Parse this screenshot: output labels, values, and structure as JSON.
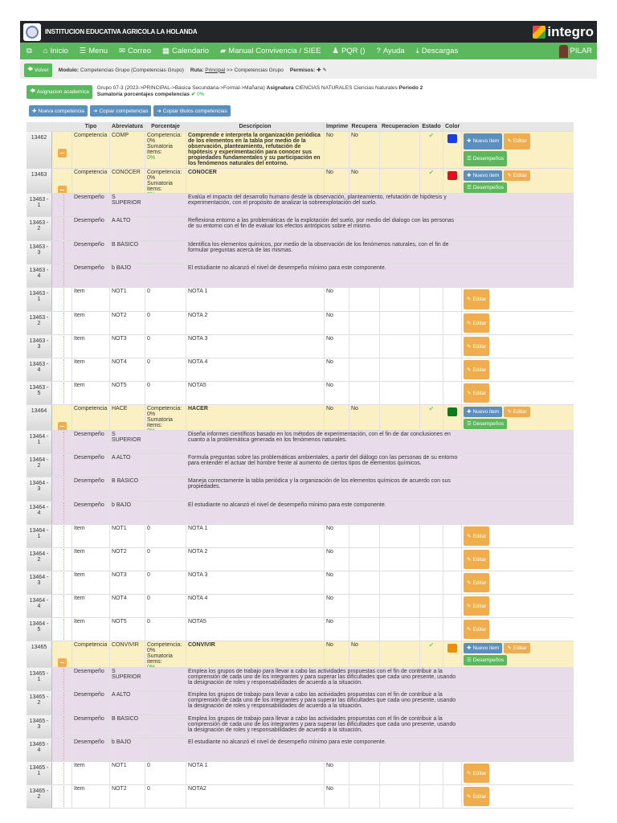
{
  "header": {
    "school": "INSTITUCION EDUCATIVA AGRICOLA LA HOLANDA",
    "brand": "integro"
  },
  "nav": {
    "items": [
      "Inicio",
      "Menu",
      "Correo",
      "Calendario",
      "Manual Convivencia / SIEE",
      "PQR ()",
      "Ayuda",
      "Descargas"
    ],
    "user": "PILAR"
  },
  "crumb": {
    "back": "Volver",
    "module_label": "Modulo:",
    "module": "Competencias Grupo (Competencias Grupo)",
    "route_label": "Ruta:",
    "route_link": "Principal",
    "route_rest": ">> Competencias Grupo",
    "perms": "Permisos:"
  },
  "info": {
    "button": "Asignacion academica",
    "line1_a": "Grupo 07-3 (2023->PRINCIPAL->Básica Secundaria->Formal->Mañana)",
    "line1_b": "Asignatura",
    "line1_c": "CIENCIAS NATURALES Ciencias Naturales",
    "line1_d": "Periodo 2",
    "line2": "Sumatoria porcentajes competencias",
    "line2_val": "0%"
  },
  "actions": [
    "Nueva competencia",
    "Copiar competencias",
    "Copiar titulos competencias"
  ],
  "table": {
    "headers": [
      "",
      "",
      "Tipo",
      "Abreviatura",
      "Porcentaje",
      "Descripcion",
      "Imprime",
      "Recupera",
      "Recuperacion",
      "Estado",
      "Color",
      ""
    ],
    "buttons": {
      "new_item": "Nuevo item",
      "edit": "Editar",
      "perf": "Desempeños"
    },
    "pct": {
      "a": "Competencia:",
      "b": "0%",
      "c": "Sumatoria items:",
      "d": "0%"
    },
    "rows": [
      {
        "kind": "comp",
        "h": 46,
        "id": "13462",
        "tipo": "Competencia",
        "abrev": "COMP",
        "desc": "Comprende e interpreta la organización periódica de los elementos en la tabla por medio de la observación, planteamiento, refutación de hipótesis y experimentación para conocer sus propiedades fundamentales y su participación en los fenómenos naturales del entorno.",
        "imprime": "No",
        "recupera": "No",
        "color": "#1a3ee0"
      },
      {
        "kind": "comp",
        "h": 31,
        "id": "13463",
        "tipo": "Competencia",
        "abrev": "CONOCER",
        "desc": "CONOCER",
        "imprime": "No",
        "recupera": "No",
        "color": "#e01020"
      },
      {
        "kind": "des",
        "h": 29,
        "id": "13463 - 1",
        "tipo": "Desempeño",
        "abrev": "S SUPERIOR",
        "desc": "Evalúa el impacto del desarrollo humano desde la observación, planteamiento, refutación de hipótesis y experimentación, con el propósito de analizar la sobreexplotación del suelo."
      },
      {
        "kind": "des",
        "h": 30,
        "id": "13463 - 2",
        "tipo": "Desempeño",
        "abrev": "A ALTO",
        "desc": "Reflexiona entorno a las problemáticas de la explotación del suelo, por medio del dialogo con las personas de su entorno con el fin de evaluar los efectos antrópicos sobre el mismo."
      },
      {
        "kind": "des",
        "h": 29,
        "id": "13463 - 3",
        "tipo": "Desempeño",
        "abrev": "B BÁSICO",
        "desc": "Identifica los elementos químicos, por medio de la observación de los fenómenos naturales, con el fin de formular preguntas acerca de las mismas."
      },
      {
        "kind": "des",
        "h": 29,
        "id": "13463 - 4",
        "tipo": "Desempeño",
        "abrev": "b BAJO",
        "desc": "El estudiante no alcanzó el nivel de desempeño mínimo para este componente."
      },
      {
        "kind": "item",
        "h": 30,
        "id": "13463 - 1",
        "tipo": "Item",
        "abrev": "NOT1",
        "pct": "0",
        "desc": "NOTA 1",
        "imprime": "No"
      },
      {
        "kind": "item",
        "h": 29,
        "id": "13463 - 2",
        "tipo": "Item",
        "abrev": "NOT2",
        "pct": "0",
        "desc": "NOTA 2",
        "imprime": "No"
      },
      {
        "kind": "item",
        "h": 29,
        "id": "13463 - 3",
        "tipo": "Item",
        "abrev": "NOT3",
        "pct": "0",
        "desc": "NOTA 3",
        "imprime": "No"
      },
      {
        "kind": "item",
        "h": 29,
        "id": "13463 - 4",
        "tipo": "Item",
        "abrev": "NOT4",
        "pct": "0",
        "desc": "NOTA 4",
        "imprime": "No"
      },
      {
        "kind": "item",
        "h": 29,
        "id": "13463 - 5",
        "tipo": "Item",
        "abrev": "NOT5",
        "pct": "0",
        "desc": "NOTA5",
        "imprime": "No"
      },
      {
        "kind": "comp",
        "h": 32,
        "id": "13464",
        "tipo": "Competencia",
        "abrev": "HACE",
        "desc": "HACER",
        "imprime": "No",
        "recupera": "No",
        "color": "#0e7a1e"
      },
      {
        "kind": "des",
        "h": 29,
        "id": "13464 - 1",
        "tipo": "Desempeño",
        "abrev": "S SUPERIOR",
        "desc": "Diseña informes científicos basado en los métodos de experimentación, con el fin de dar conclusiones en cuanto a la problemática generada en los fenómenos naturales."
      },
      {
        "kind": "des",
        "h": 29,
        "id": "13464 - 2",
        "tipo": "Desempeño",
        "abrev": "A ALTO",
        "desc": "Formula preguntas sobre las problemáticas ambientales, a partir del diálogo con las personas de su entorno para entender el actuar del hombre frente al aumento de ciertos tipos de elementos químicos."
      },
      {
        "kind": "des",
        "h": 30,
        "id": "13464 - 3",
        "tipo": "Desempeño",
        "abrev": "B BÁSICO",
        "desc": "Maneja correctamente la tabla periódica y la organización de los elementos químicos de acuerdo con sus propiedades."
      },
      {
        "kind": "des",
        "h": 29,
        "id": "13464 - 4",
        "tipo": "Desempeño",
        "abrev": "b BAJO",
        "desc": "El estudiante no alcanzó el nivel de desempeño mínimo para este componente."
      },
      {
        "kind": "item",
        "h": 29,
        "id": "13464 - 1",
        "tipo": "Item",
        "abrev": "NOT1",
        "pct": "0",
        "desc": "NOTA 1",
        "imprime": "No"
      },
      {
        "kind": "item",
        "h": 29,
        "id": "13464 - 2",
        "tipo": "Item",
        "abrev": "NOT2",
        "pct": "0",
        "desc": "NOTA 2",
        "imprime": "No"
      },
      {
        "kind": "item",
        "h": 29,
        "id": "13464 - 3",
        "tipo": "Item",
        "abrev": "NOT3",
        "pct": "0",
        "desc": "NOTA 3",
        "imprime": "No"
      },
      {
        "kind": "item",
        "h": 29,
        "id": "13464 - 4",
        "tipo": "Item",
        "abrev": "NOT4",
        "pct": "0",
        "desc": "NOTA 4",
        "imprime": "No"
      },
      {
        "kind": "item",
        "h": 29,
        "id": "13464 - 5",
        "tipo": "Item",
        "abrev": "NOT5",
        "pct": "0",
        "desc": "NOTA5",
        "imprime": "No"
      },
      {
        "kind": "comp",
        "h": 33,
        "id": "13465",
        "tipo": "Competencia",
        "abrev": "CONVIVIR",
        "desc": "CONVIVIR",
        "imprime": "No",
        "recupera": "No",
        "color": "#e8900c"
      },
      {
        "kind": "des",
        "h": 29,
        "id": "13465 - 1",
        "tipo": "Desempeño",
        "abrev": "S SUPERIOR",
        "desc": "Emplea los grupos de trabajo para llevar a cabo las actividades propuestas con el fin de contribuir a la comprensión de cada uno de los integrantes y para superar las dificultades que cada uno presente, usando la designación de roles y responsabilidades de acuerdo a la situación."
      },
      {
        "kind": "des",
        "h": 30,
        "id": "13465 - 2",
        "tipo": "Desempeño",
        "abrev": "A ALTO",
        "desc": "Emplea los grupos de trabajo para llevar a cabo las actividades propuestas con el fin de contribuir a la comprensión de cada uno de los integrantes y para superar las dificultades que cada uno presente, usando la designación de roles y responsabilidades de acuerdo a la situación."
      },
      {
        "kind": "des",
        "h": 29,
        "id": "13465 - 3",
        "tipo": "Desempeño",
        "abrev": "B BÁSICO",
        "desc": "Emplea los grupos de trabajo para llevar a cabo las actividades propuestas con el fin de contribuir a la comprensión de cada uno de los integrantes y para superar las dificultades que cada uno presente, usando la designación de roles y responsabilidades de acuerdo a la situación."
      },
      {
        "kind": "des",
        "h": 29,
        "id": "13465 - 4",
        "tipo": "Desempeño",
        "abrev": "b BAJO",
        "desc": "El estudiante no alcanzó el nivel de desempeño mínimo para este componente."
      },
      {
        "kind": "item",
        "h": 29,
        "id": "13465 - 1",
        "tipo": "Item",
        "abrev": "NOT1",
        "pct": "0",
        "desc": "NOTA 1",
        "imprime": "No"
      },
      {
        "kind": "item",
        "h": 29,
        "id": "13465 - 2",
        "tipo": "Item",
        "abrev": "NOT2",
        "pct": "0",
        "desc": "NOTA2",
        "imprime": "No"
      }
    ]
  }
}
